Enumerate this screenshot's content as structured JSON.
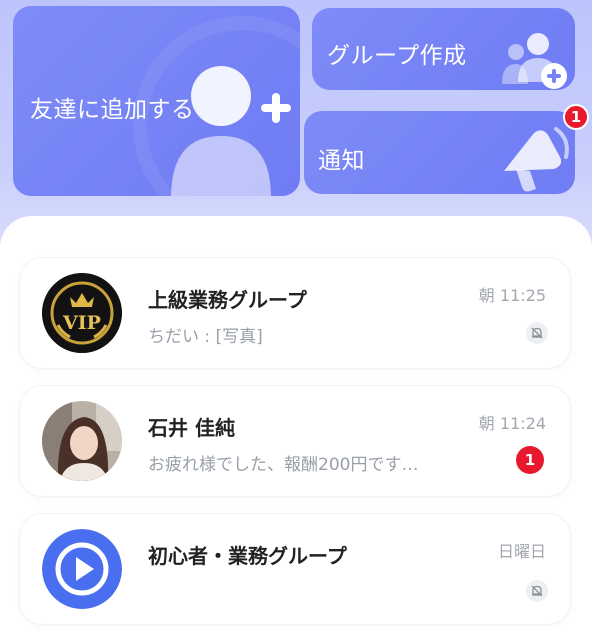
{
  "actions": {
    "add_friend": "友達に追加する",
    "create_group": "グループ作成",
    "notifications": "通知",
    "notifications_badge": "1"
  },
  "chats": [
    {
      "name": "上級業務グループ",
      "preview": "ちだい : [写真]",
      "time": "朝 11:25",
      "muted": true,
      "avatar_icon": "vip-badge-icon",
      "avatar_text": "VIP"
    },
    {
      "name": "石井 佳純",
      "preview": "お疲れ様でした、報酬200円です…",
      "time": "朝 11:24",
      "unread": "1",
      "avatar_icon": "person-photo"
    },
    {
      "name": "初心者・業務グループ",
      "preview": "",
      "time": "日曜日",
      "muted": true,
      "avatar_icon": "play-icon"
    }
  ],
  "colors": {
    "card": "#7581f6",
    "background_top": "#c3c9fc",
    "badge": "#e8192c",
    "play_blue": "#4a6ef0"
  }
}
